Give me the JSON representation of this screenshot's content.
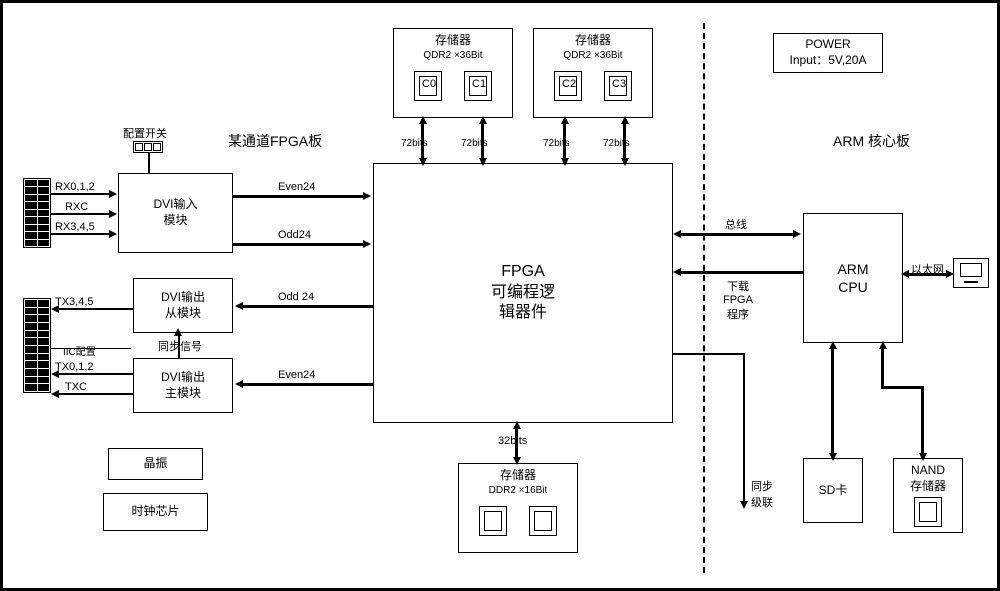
{
  "titles": {
    "fpga_board": "某通道FPGA板",
    "arm_board": "ARM 核心板"
  },
  "mem_top1": {
    "title": "存储器",
    "subtitle": "QDR2 ×36Bit",
    "c0": "C0",
    "c1": "C1"
  },
  "mem_top2": {
    "title": "存储器",
    "subtitle": "QDR2 ×36Bit",
    "c2": "C2",
    "c3": "C3"
  },
  "mem_bottom": {
    "title": "存储器",
    "subtitle": "DDR2 ×16Bit"
  },
  "power": {
    "line1": "POWER",
    "line2": "Input：5V,20A"
  },
  "dvi_in": {
    "label": "DVI输入\n模块",
    "config": "配置开关"
  },
  "dvi_out_slave": "DVI输出\n从模块",
  "dvi_out_master": "DVI输出\n主模块",
  "sync_signal": "同步信号",
  "iic": "IIC配置",
  "fpga": "FPGA\n可编程逻\n辑器件",
  "arm": "ARM\nCPU",
  "sd": "SD卡",
  "nand": "NAND\n存储器",
  "osc": "晶振",
  "clock": "时钟芯片",
  "signals": {
    "rx012": "RX0,1,2",
    "rxc": "RXC",
    "rx345": "RX3,4,5",
    "tx345": "TX3,4,5",
    "tx012": "TX0,1,2",
    "txc": "TXC",
    "even24_1": "Even24",
    "odd24_1": "Odd24",
    "odd24_2": "Odd 24",
    "even24_2": "Even24",
    "bits72_1": "72bits",
    "bits72_2": "72bits",
    "bits72_3": "72bits",
    "bits72_4": "72bits",
    "bits32": "32bits",
    "bus": "总线",
    "download": "下载\nFPGA\n程序",
    "sync_cascade": "同步\n级联",
    "ethernet": "以太网"
  }
}
